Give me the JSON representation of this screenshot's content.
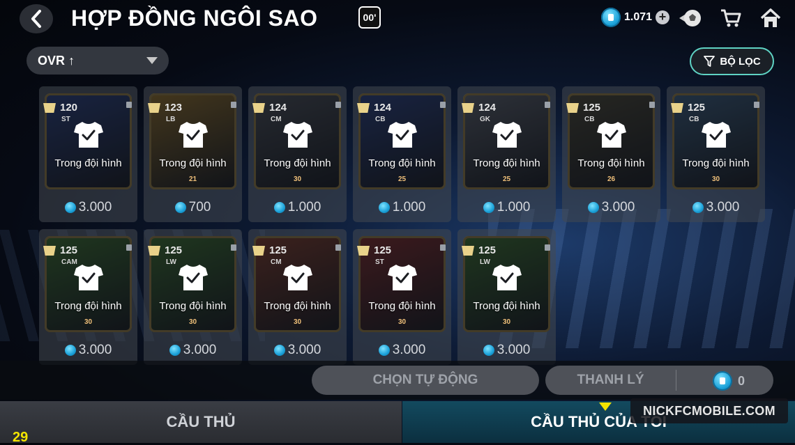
{
  "header": {
    "title": "HỢP ĐỒNG NGÔI SAO",
    "badge": "00'",
    "currency_amount": "1.071"
  },
  "controls": {
    "sort_label": "OVR ↑",
    "filter_label": "BỘ LỌC"
  },
  "cards": [
    {
      "ovr": "120",
      "pos": "ST",
      "level": "",
      "status": "Trong đội hình",
      "price": "3.000",
      "art_color": "#2c3f7a"
    },
    {
      "ovr": "123",
      "pos": "LB",
      "level": "21",
      "status": "Trong đội hình",
      "price": "700",
      "art_color": "#8a6a2a"
    },
    {
      "ovr": "124",
      "pos": "CM",
      "level": "30",
      "status": "Trong đội hình",
      "price": "1.000",
      "art_color": "#4a4d55"
    },
    {
      "ovr": "124",
      "pos": "CB",
      "level": "25",
      "status": "Trong đội hình",
      "price": "1.000",
      "art_color": "#2c3f7a"
    },
    {
      "ovr": "124",
      "pos": "GK",
      "level": "25",
      "status": "Trong đội hình",
      "price": "1.000",
      "art_color": "#5a5e68"
    },
    {
      "ovr": "125",
      "pos": "CB",
      "level": "26",
      "status": "Trong đội hình",
      "price": "3.000",
      "art_color": "#4a4636"
    },
    {
      "ovr": "125",
      "pos": "CB",
      "level": "30",
      "status": "Trong đội hình",
      "price": "3.000",
      "art_color": "#3c5a78"
    },
    {
      "ovr": "125",
      "pos": "CAM",
      "level": "30",
      "status": "Trong đội hình",
      "price": "3.000",
      "art_color": "#3b6a2f"
    },
    {
      "ovr": "125",
      "pos": "LW",
      "level": "30",
      "status": "Trong đội hình",
      "price": "3.000",
      "art_color": "#3b6a2f"
    },
    {
      "ovr": "125",
      "pos": "CM",
      "level": "30",
      "status": "Trong đội hình",
      "price": "3.000",
      "art_color": "#7a3a2a"
    },
    {
      "ovr": "125",
      "pos": "ST",
      "level": "30",
      "status": "Trong đội hình",
      "price": "3.000",
      "art_color": "#7a2a2a"
    },
    {
      "ovr": "125",
      "pos": "LW",
      "level": "30",
      "status": "Trong đội hình",
      "price": "3.000",
      "art_color": "#3b6a2f"
    }
  ],
  "actions": {
    "auto_select": "CHỌN TỰ ĐỘNG",
    "sell": "THANH LÝ",
    "sell_amount": "0"
  },
  "tabs": {
    "players": "CẦU THỦ",
    "my_players": "CẦU THỦ CỦA TÔI"
  },
  "watermark": "NICKFCMOBILE.COM",
  "corner_counter": "29"
}
